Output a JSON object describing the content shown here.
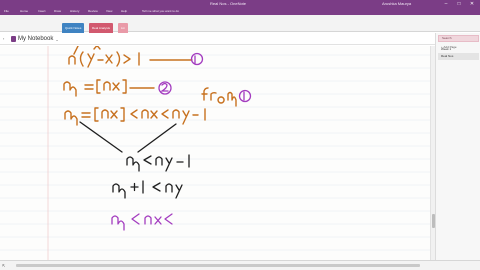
{
  "window": {
    "title": "Real Nos - OneNote",
    "user": "Arushka Maurya",
    "min_glyph": "–",
    "max_glyph": "□",
    "close_glyph": "✕"
  },
  "menu": {
    "items": [
      {
        "name": "menu-file",
        "label": "File"
      },
      {
        "name": "menu-home",
        "label": "Home"
      },
      {
        "name": "menu-insert",
        "label": "Insert"
      },
      {
        "name": "menu-draw",
        "label": "Draw"
      },
      {
        "name": "menu-history",
        "label": "History"
      },
      {
        "name": "menu-review",
        "label": "Review"
      },
      {
        "name": "menu-view",
        "label": "View"
      },
      {
        "name": "menu-help",
        "label": "Help"
      }
    ],
    "tell_me": "Tell me what you want to do"
  },
  "notebook": {
    "back_glyph": "‹",
    "name": "My Notebook",
    "chevron": "⌄",
    "section_tabs": [
      {
        "label": "Quick Notes",
        "color": "#3f83c2"
      },
      {
        "label": "Real Analysis",
        "color": "#d2596f"
      },
      {
        "label": "Lin",
        "color": "#e99aa8"
      }
    ],
    "add_tab_glyph": "+"
  },
  "canvas": {
    "ruled_lines_color": "#dde3ee",
    "margin_line_color": "#e9b4b4",
    "ink_colors": {
      "primary": "#c7711f",
      "black": "#1f1f1f",
      "purple": "#a33cbf"
    }
  },
  "pages": {
    "search_placeholder": "Search",
    "add_page_label": "+ Add Page",
    "items": [
      {
        "title": "Week 1"
      },
      {
        "title": "Real Nos"
      }
    ]
  }
}
